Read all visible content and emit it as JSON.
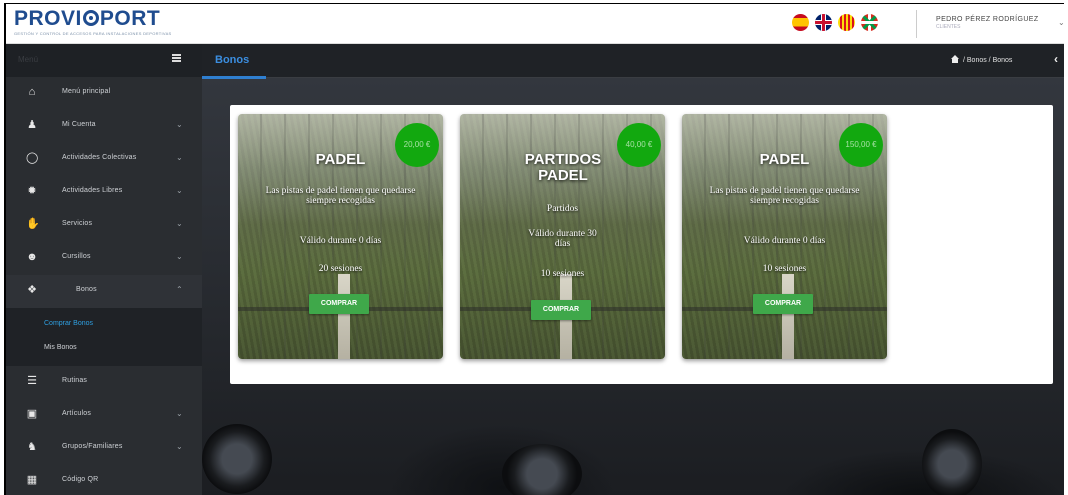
{
  "header": {
    "logo_text_a": "PROVI",
    "logo_text_b": "PORT",
    "logo_subtitle": "GESTIÓN Y CONTROL DE ACCESOS PARA INSTALACIONES DEPORTIVAS",
    "user_name": "PEDRO PÉREZ RODRÍGUEZ",
    "user_role": "CLIENTES",
    "languages": [
      "es-flag-icon",
      "uk-flag-icon",
      "catalan-flag-icon",
      "basque-flag-icon"
    ]
  },
  "sidebar": {
    "menu_label": "Menú",
    "items": [
      {
        "label": "Menú principal",
        "icon": "home-icon"
      },
      {
        "label": "Mi Cuenta",
        "icon": "user-icon"
      },
      {
        "label": "Actividades Colectivas",
        "icon": "bicycle-icon"
      },
      {
        "label": "Actividades Libres",
        "icon": "ball-icon"
      },
      {
        "label": "Servicios",
        "icon": "thumbs-up-icon"
      },
      {
        "label": "Cursillos",
        "icon": "users-icon"
      },
      {
        "label": "Bonos",
        "icon": "tags-icon"
      },
      {
        "label": "Rutinas",
        "icon": "list-icon"
      },
      {
        "label": "Artículos",
        "icon": "cart-icon"
      },
      {
        "label": "Grupos/Familiares",
        "icon": "group-icon"
      },
      {
        "label": "Código QR",
        "icon": "qr-icon"
      }
    ],
    "bonos_sub": [
      {
        "label": "Comprar Bonos"
      },
      {
        "label": "Mis Bonos"
      }
    ]
  },
  "page": {
    "title": "Bonos",
    "breadcrumb": "/ Bonos / Bonos"
  },
  "cards": [
    {
      "title": "PADEL",
      "price": "20,00 €",
      "description": "Las pistas de padel tienen que quedarse siempre recogidas",
      "validity": "Válido durante 0 días",
      "sessions": "20 sesiones",
      "button": "COMPRAR"
    },
    {
      "title": "PARTIDOS PADEL",
      "price": "40,00 €",
      "description": "Partidos",
      "validity": "Válido durante 30 días",
      "sessions": "10 sesiones",
      "button": "COMPRAR"
    },
    {
      "title": "PADEL",
      "price": "150,00 €",
      "description": "Las pistas de padel tienen que quedarse siempre recogidas",
      "validity": "Válido durante 0 días",
      "sessions": "10 sesiones",
      "button": "COMPRAR"
    }
  ],
  "colors": {
    "accent_blue": "#2f7fd0",
    "price_green": "#12a80f",
    "button_green": "#3fa84a",
    "sidebar_bg": "#2a2d31",
    "logo_blue": "#1f4c8f"
  }
}
